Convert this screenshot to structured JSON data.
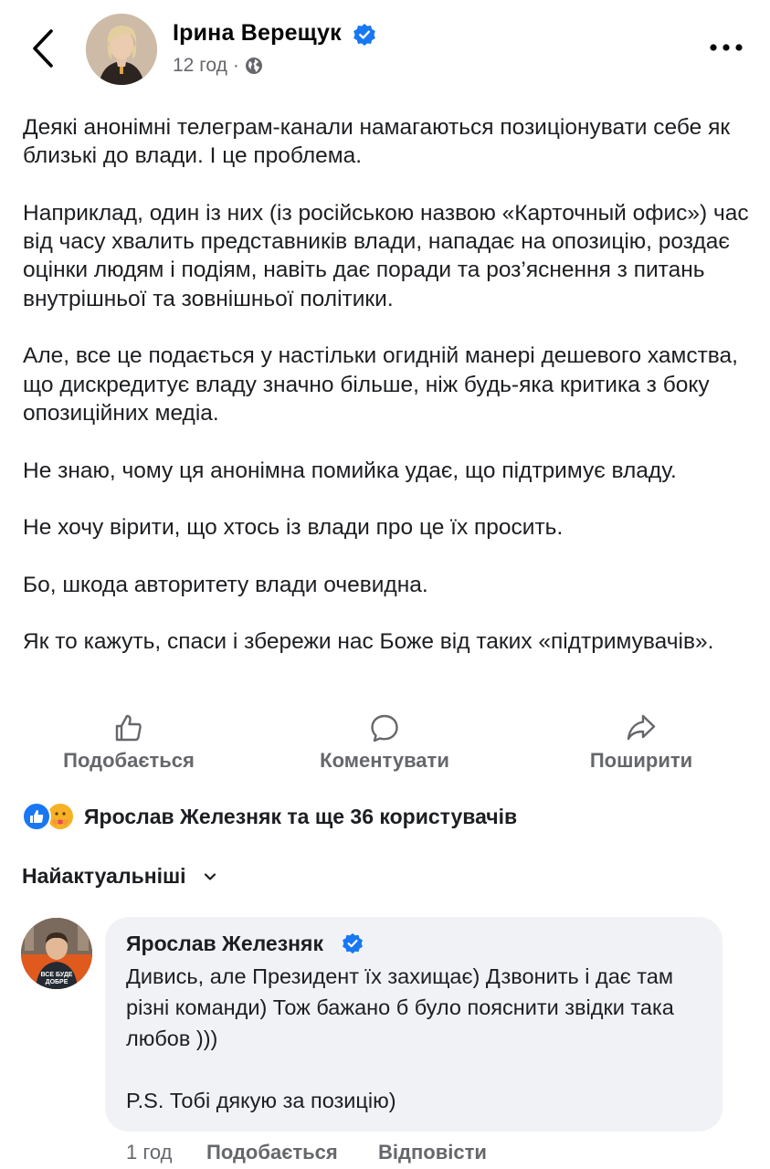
{
  "post": {
    "author": "Ірина Верещук",
    "time": "12 год",
    "separator": "·",
    "paragraphs": [
      "Деякі анонімні телеграм-канали намагаються позиціонувати себе як близькі до влади. І це проблема.",
      "Наприклад, один із них (із російською назвою «Карточный офис») час від часу хвалить представників влади, нападає на опозицію, роздає оцінки людям і подіям, навіть дає поради та роз’яснення з питань внутрішньої та зовнішньої політики.",
      "Але, все це подається у настільки огидній манері дешевого хамства, що дискредитує владу значно більше, ніж будь-яка критика з боку опозиційних медіа.",
      "Не знаю, чому ця анонімна помийка удає, що підтримує владу.",
      "Не хочу вірити, що хтось із влади про це їх просить.",
      "Бо, шкода авторитету влади очевидна.",
      "Як то кажуть, спаси і збережи нас Боже від таких «підтримувачів»."
    ]
  },
  "actions": {
    "like": "Подобається",
    "comment": "Коментувати",
    "share": "Поширити"
  },
  "reactions": {
    "summary": "Ярослав Железняк та ще 36 користувачів"
  },
  "sort": {
    "label": "Найактуальніші"
  },
  "comment": {
    "author": "Ярослав Железняк",
    "avatar_badge": "ВСЕ БУДЕ ДОБРЕ",
    "paragraphs": [
      "Дивись, але Президент їх захищає) Дзвонить і дає там різні команди) Тож бажано б було пояснити звідки така любов )))",
      "P.S. Тобі дякую за позицію)"
    ],
    "time": "1 год",
    "like_label": "Подобається",
    "reply_label": "Відповісти"
  },
  "colors": {
    "brand_blue": "#1877f2",
    "secondary_text": "#65676b",
    "bubble_bg": "#f0f2f5"
  }
}
